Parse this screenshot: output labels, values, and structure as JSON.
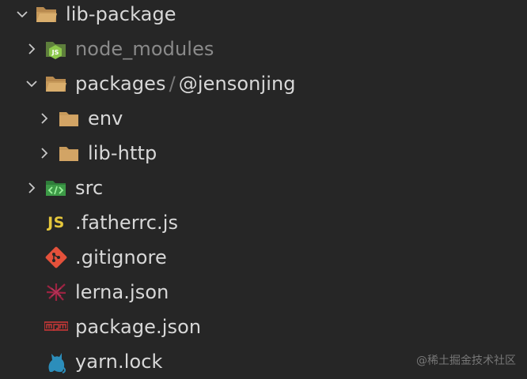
{
  "tree": {
    "root": {
      "label": "lib-package",
      "expanded": true
    },
    "items": [
      {
        "label": "node_modules",
        "type": "folder-node",
        "expanded": false
      },
      {
        "label": "packages",
        "compact_suffix": "@jensonjing",
        "separator": "/",
        "type": "folder",
        "expanded": true
      },
      {
        "label": "env",
        "type": "folder",
        "expanded": false
      },
      {
        "label": "lib-http",
        "type": "folder",
        "expanded": false
      },
      {
        "label": "src",
        "type": "folder-src",
        "expanded": false
      },
      {
        "label": ".fatherrc.js",
        "type": "js-file",
        "icon_text": "JS"
      },
      {
        "label": ".gitignore",
        "type": "git-file"
      },
      {
        "label": "lerna.json",
        "type": "lerna-file"
      },
      {
        "label": "package.json",
        "type": "npm-file"
      },
      {
        "label": "yarn.lock",
        "type": "yarn-file"
      }
    ]
  },
  "watermark": "@稀土掘金技术社区",
  "colors": {
    "background": "#262626",
    "folder": "#c79a5b",
    "node_green": "#8cc84b",
    "src_green": "#4caf50",
    "js_yellow": "#e5c73c",
    "git_red": "#e4513b",
    "lerna_red": "#9b2341",
    "npm_red": "#cb3837",
    "yarn_blue": "#2c8ebb"
  }
}
